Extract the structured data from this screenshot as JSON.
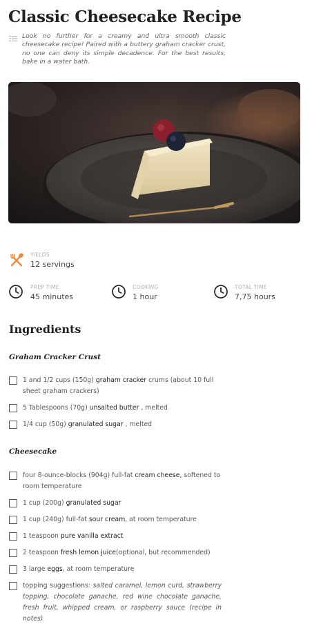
{
  "recipe": {
    "title": "Classic Cheesecake Recipe",
    "summary": "Look no further for a creamy and ultra smooth classic cheesecake recipe! Paired with a buttery graham cracker crust, no one can deny its simple decadence. For the best results, bake in a water bath."
  },
  "meta": {
    "yields": {
      "label": "YIELDS",
      "value": "12 servings",
      "icon": "fork-spoon-icon"
    },
    "prep": {
      "label": "PREP TIME",
      "value": "45 minutes",
      "icon": "clock-icon"
    },
    "cooking": {
      "label": "COOKING",
      "value": "1 hour",
      "icon": "clock-icon"
    },
    "total": {
      "label": "TOTAL TIME",
      "value": "7,75 hours",
      "icon": "clock-icon"
    }
  },
  "ingredients": {
    "heading": "Ingredients",
    "groups": [
      {
        "title": "Graham Cracker Crust",
        "items": [
          {
            "pre": "1 and 1/2 cups (150g) ",
            "bold": "graham cracker",
            "post": " crums (about 10 full sheet graham crackers)"
          },
          {
            "pre": "5 Tablespoons (70g) ",
            "bold": "unsalted butter",
            "post": " , melted"
          },
          {
            "pre": "1/4 cup (50g) ",
            "bold": "granulated sugar",
            "post": " , melted"
          }
        ]
      },
      {
        "title": "Cheesecake",
        "items": [
          {
            "pre": "four 8-ounce-blocks (904g) full-fat ",
            "bold": "cream cheese",
            "post": ", softened to room temperature"
          },
          {
            "pre": "1 cup (200g) ",
            "bold": "granulated sugar",
            "post": ""
          },
          {
            "pre": "1 cup (240g) full-fat ",
            "bold": "sour cream",
            "post": ", at room temperature"
          },
          {
            "pre": "1 teaspoon ",
            "bold": "pure vanilla extract",
            "post": ""
          },
          {
            "pre": "2 teaspoon ",
            "bold": "fresh lemon juice",
            "post": "(optional, but recommended)"
          },
          {
            "pre": "3 large ",
            "bold": "eggs",
            "post": ", at room temperature"
          },
          {
            "pre": "topping suggestions: ",
            "italic": "salted caramel, lemon curd, strawberry topping, chocolate ganache, red wine chocolate ganache, fresh fruit, whipped cream, or raspberry sauce (recipe in notes)"
          }
        ]
      }
    ]
  },
  "colors": {
    "accent": "#f0873a",
    "text": "#333333",
    "muted": "#b0b0b0"
  }
}
